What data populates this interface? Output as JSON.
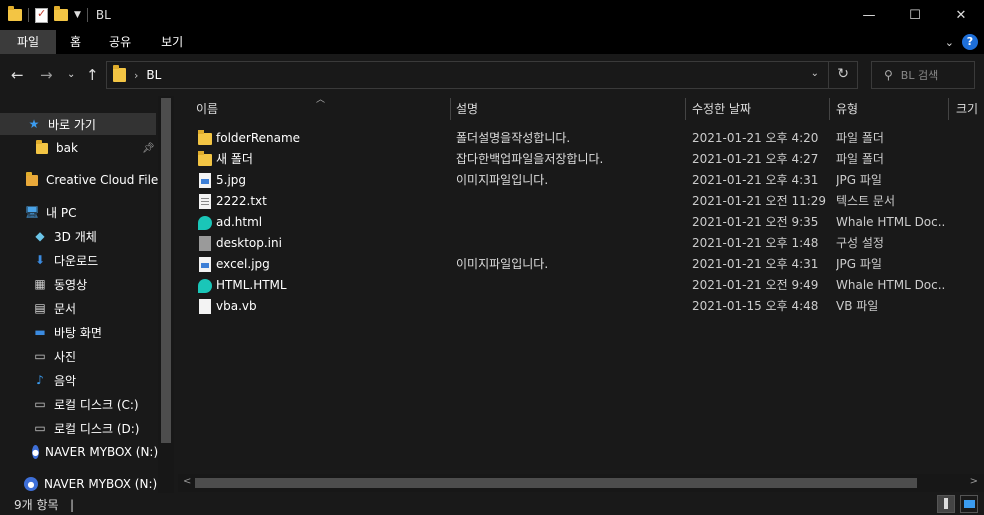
{
  "window": {
    "title": "BL",
    "controls": {
      "minimize": "—",
      "maximize": "☐",
      "close": "✕"
    }
  },
  "ribbon": {
    "tabs": [
      "파일",
      "홈",
      "공유",
      "보기"
    ],
    "help": "?"
  },
  "address": {
    "path": "BL",
    "search_placeholder": "BL 검색"
  },
  "nav": {
    "items": [
      {
        "label": "바로 가기",
        "icon": "star-icon"
      },
      {
        "label": "bak",
        "icon": "folder-icon",
        "pinned": true
      },
      {
        "label": "Creative Cloud Files",
        "icon": "creative-cloud-icon"
      },
      {
        "label": "내 PC",
        "icon": "pc-icon"
      },
      {
        "label": "3D 개체",
        "icon": "3d-objects-icon"
      },
      {
        "label": "다운로드",
        "icon": "download-icon"
      },
      {
        "label": "동영상",
        "icon": "video-icon"
      },
      {
        "label": "문서",
        "icon": "document-icon"
      },
      {
        "label": "바탕 화면",
        "icon": "desktop-icon"
      },
      {
        "label": "사진",
        "icon": "pictures-icon"
      },
      {
        "label": "음악",
        "icon": "music-icon"
      },
      {
        "label": "로컬 디스크 (C:)",
        "icon": "drive-icon"
      },
      {
        "label": "로컬 디스크 (D:)",
        "icon": "drive-icon"
      },
      {
        "label": "NAVER MYBOX (N:)",
        "icon": "mybox-icon"
      },
      {
        "label": "NAVER MYBOX (N:)",
        "icon": "mybox-icon"
      }
    ]
  },
  "list": {
    "columns": [
      "이름",
      "설명",
      "수정한 날짜",
      "유형",
      "크기"
    ],
    "rows": [
      {
        "name": "folderRename",
        "desc": "폴더설명을작성합니다.",
        "date": "2021-01-21 오후 4:20",
        "type": "파일 폴더",
        "icon": "folder"
      },
      {
        "name": "새 폴더",
        "desc": "잡다한백업파일을저장합니다.",
        "date": "2021-01-21 오후 4:27",
        "type": "파일 폴더",
        "icon": "folder"
      },
      {
        "name": "5.jpg",
        "desc": "이미지파일입니다.",
        "date": "2021-01-21 오후 4:31",
        "type": "JPG 파일",
        "icon": "jpg"
      },
      {
        "name": "2222.txt",
        "desc": "",
        "date": "2021-01-21 오전 11:29",
        "type": "텍스트 문서",
        "icon": "txt"
      },
      {
        "name": "ad.html",
        "desc": "",
        "date": "2021-01-21 오전 9:35",
        "type": "Whale HTML Doc...",
        "icon": "whale"
      },
      {
        "name": "desktop.ini",
        "desc": "",
        "date": "2021-01-21 오후 1:48",
        "type": "구성 설정",
        "icon": "ini"
      },
      {
        "name": "excel.jpg",
        "desc": "이미지파일입니다.",
        "date": "2021-01-21 오후 4:31",
        "type": "JPG 파일",
        "icon": "jpg"
      },
      {
        "name": "HTML.HTML",
        "desc": "",
        "date": "2021-01-21 오전 9:49",
        "type": "Whale HTML Doc...",
        "icon": "whale"
      },
      {
        "name": "vba.vb",
        "desc": "",
        "date": "2021-01-15 오후 4:48",
        "type": "VB 파일",
        "icon": "vb"
      }
    ]
  },
  "status": {
    "item_count": "9개 항목",
    "cursor": "|"
  }
}
